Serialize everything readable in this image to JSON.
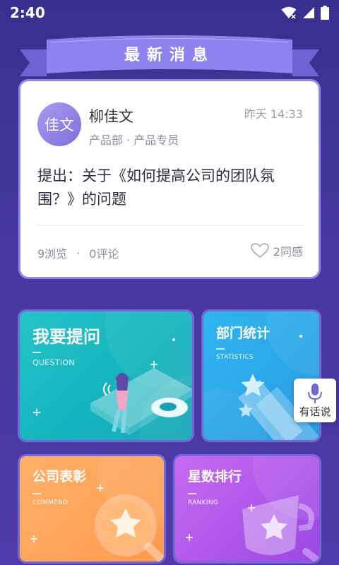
{
  "status_bar": {
    "time": "2:40"
  },
  "ribbon": {
    "title": "最新消息"
  },
  "news": {
    "avatar_text": "佳文",
    "author": "柳佳文",
    "department": "产品部 · 产品专员",
    "time": "昨天 14:33",
    "content": "提出：关于《如何提高公司的团队氛围？》的问题",
    "views": "9浏览",
    "separator": "·",
    "comments": "0评论",
    "likes": "2同感"
  },
  "tiles": {
    "question": {
      "title": "我要提问",
      "subtitle": "QUESTION"
    },
    "dept": {
      "title": "部门统计",
      "subtitle": "STATISTICS"
    },
    "commend": {
      "title": "公司表彰",
      "subtitle": "COMMEND"
    },
    "ranking": {
      "title": "星数排行",
      "subtitle": "RANKING"
    }
  },
  "voice": {
    "label": "有话说",
    "icon": "microphone-icon"
  },
  "colors": {
    "background": "#3a2f8f",
    "accent": "#7b6fde",
    "question": "#1fbcc4",
    "dept": "#2ea8ea",
    "commend": "#ffa65a",
    "ranking": "#b058ec"
  }
}
